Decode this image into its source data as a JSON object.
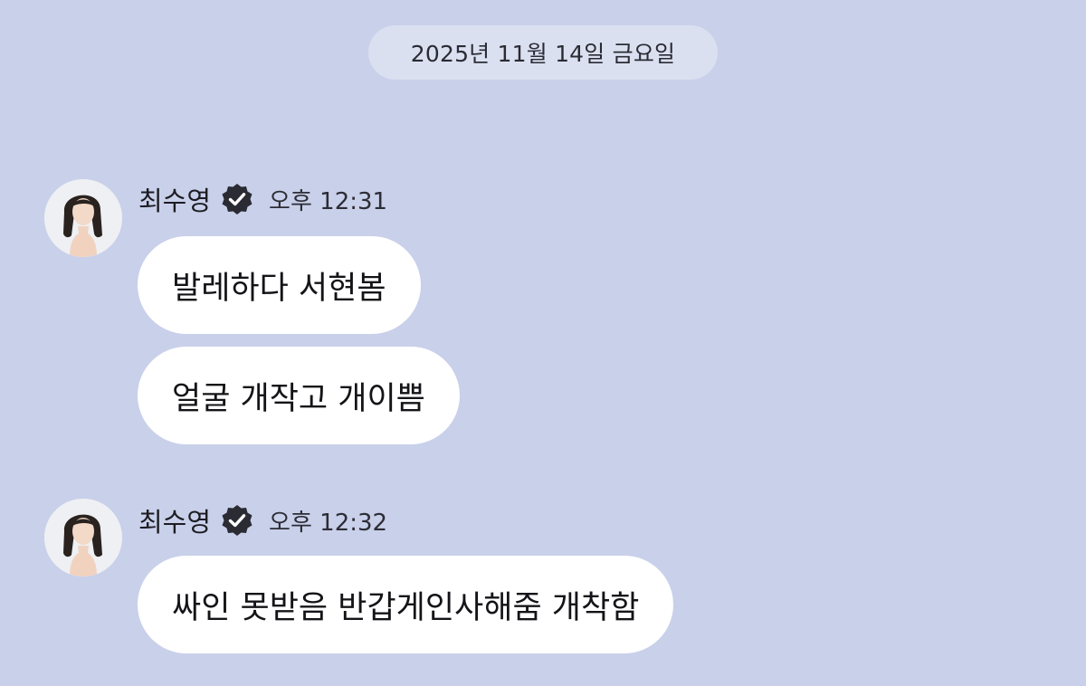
{
  "date_divider": "2025년 11월 14일 금요일",
  "colors": {
    "background": "#c9d0ea",
    "date_pill": "#dbe0f1",
    "bubble": "#ffffff",
    "verified_badge": "#2a2b33"
  },
  "messages": [
    {
      "sender": "최수영",
      "verified_icon": "verified-badge-icon",
      "time": "오후 12:31",
      "bubbles": [
        "발레하다 서현봄",
        "얼굴 개작고 개이쁨"
      ]
    },
    {
      "sender": "최수영",
      "verified_icon": "verified-badge-icon",
      "time": "오후 12:32",
      "bubbles": [
        "싸인 못받음 반갑게인사해줌 개착함"
      ]
    }
  ]
}
